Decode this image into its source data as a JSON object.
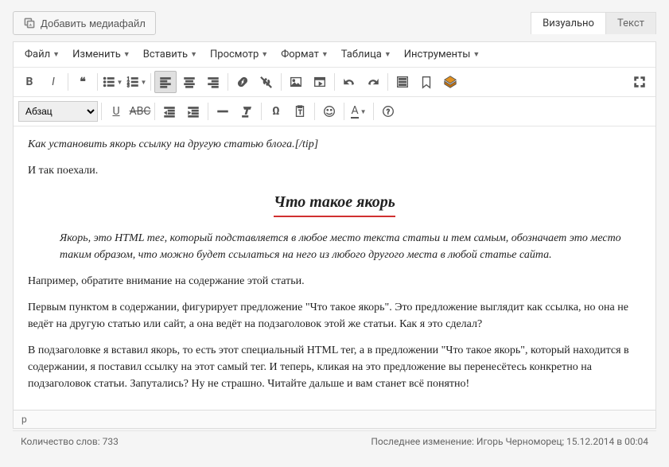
{
  "media_button": "Добавить медиафайл",
  "tabs": {
    "visual": "Визуально",
    "text": "Текст"
  },
  "menus": [
    "Файл",
    "Изменить",
    "Вставить",
    "Просмотр",
    "Формат",
    "Таблица",
    "Инструменты"
  ],
  "format_select": "Абзац",
  "content": {
    "tip": "Как установить якорь ссылку на другую статью блога.[/tip]",
    "p1": "И так поехали.",
    "heading": "Что такое якорь",
    "quote": "Якорь, это HTML тег, который подставляется в любое место текста статьи и тем самым, обозначает это место таким образом, что можно будет ссылаться на него из любого другого места в любой статье сайта.",
    "p2": "Например, обратите внимание на содержание этой статьи.",
    "p3": "Первым пунктом в содержании, фигурирует предложение \"Что такое якорь\". Это предложение выглядит как ссылка, но она не ведёт на другую статью или сайт, а она ведёт на подзаголовок этой же статьи. Как я это сделал?",
    "p4": "В подзаголовке я вставил якорь, то есть этот специальный HTML тег, а в предложении \"Что такое якорь\", который находится в содержании, я поставил ссылку на этот самый тег. И теперь, кликая на это предложение вы перенесётесь конкретно на подзаголовок статьи. Запутались? Ну не страшно. Читайте дальше и вам станет всё понятно!"
  },
  "status_path": "p",
  "word_count_label": "Количество слов:",
  "word_count": "733",
  "last_edit_label": "Последнее изменение:",
  "last_edit_value": "Игорь Черноморец; 15.12.2014 в 00:04"
}
